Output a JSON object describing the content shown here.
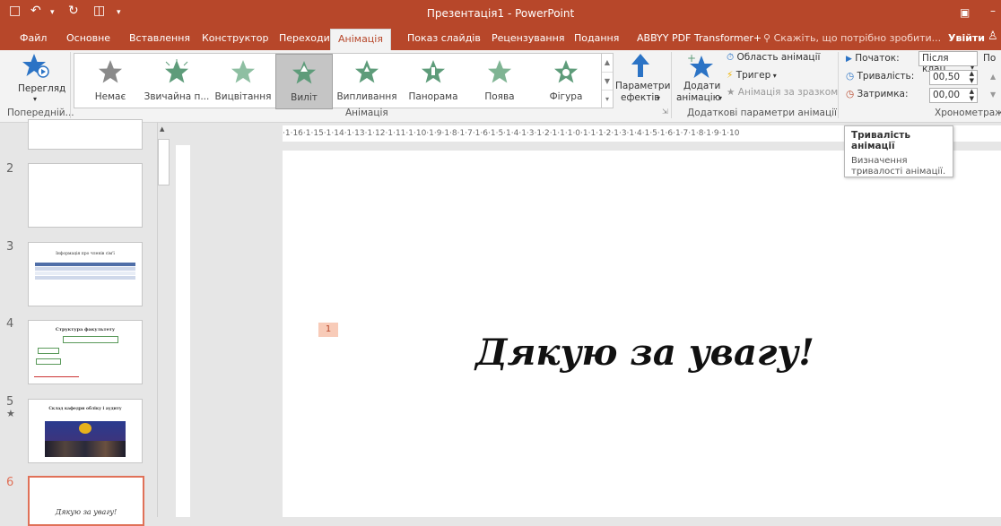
{
  "window": {
    "title": "Презентація1 - PowerPoint"
  },
  "tabs": [
    "Файл",
    "Основне",
    "Вставлення",
    "Конструктор",
    "Переходи",
    "Анімація",
    "Показ слайдів",
    "Рецензування",
    "Подання",
    "ABBYY PDF Transformer+"
  ],
  "tell_me": "Скажіть, що потрібно зробити...",
  "sign_in": "Увійти",
  "preview": {
    "label": "Перегляд",
    "group": "Попередній..."
  },
  "animations": {
    "items": [
      "Немає",
      "Звичайна п...",
      "Вицвітання",
      "Виліт",
      "Випливання",
      "Панорама",
      "Поява",
      "Фігура"
    ],
    "selected": "Виліт",
    "group": "Анімація",
    "effect_options_line1": "Параметри",
    "effect_options_line2": "ефектів"
  },
  "advanced": {
    "add_line1": "Додати",
    "add_line2": "анімацію",
    "pane": "Область анімації",
    "trigger": "Тригер",
    "painter": "Анімація за зразком",
    "group": "Додаткові параметри анімації"
  },
  "timing": {
    "start_label": "Початок:",
    "start_value": "Після клац...",
    "duration_label": "Тривалість:",
    "duration_value": "00,50",
    "delay_label": "Затримка:",
    "delay_value": "00,00",
    "group": "Хронометраж",
    "cut": "По"
  },
  "slides": [
    {
      "num": "2"
    },
    {
      "num": "3",
      "text": "Інформація про членів сім'ї"
    },
    {
      "num": "4",
      "text": "Структура факультету"
    },
    {
      "num": "5",
      "star": "★",
      "text": "Склад кафедри обліку і аудиту"
    },
    {
      "num": "6",
      "text": "Дякую за увагу!"
    }
  ],
  "ruler_text": "·1·16·1·15·1·14·1·13·1·12·1·11·1·10·1·9·1·8·1·7·1·6·1·5·1·4·1·3·1·2·1·1·1·0·1·1·1·2·1·3·1·4·1·5·1·6·1·7·1·8·1·9·1·10",
  "slide": {
    "text": "Дякую за увагу!",
    "anim_tag": "1"
  },
  "tooltip": {
    "title": "Тривалість анімації",
    "desc_line1": "Визначення",
    "desc_line2": "тривалості анімації."
  },
  "colors": {
    "accent": "#b7472a",
    "star_gray": "#8a8a8a",
    "star_green": "#5e9c7a",
    "tag_bg": "#f8cbb8"
  }
}
